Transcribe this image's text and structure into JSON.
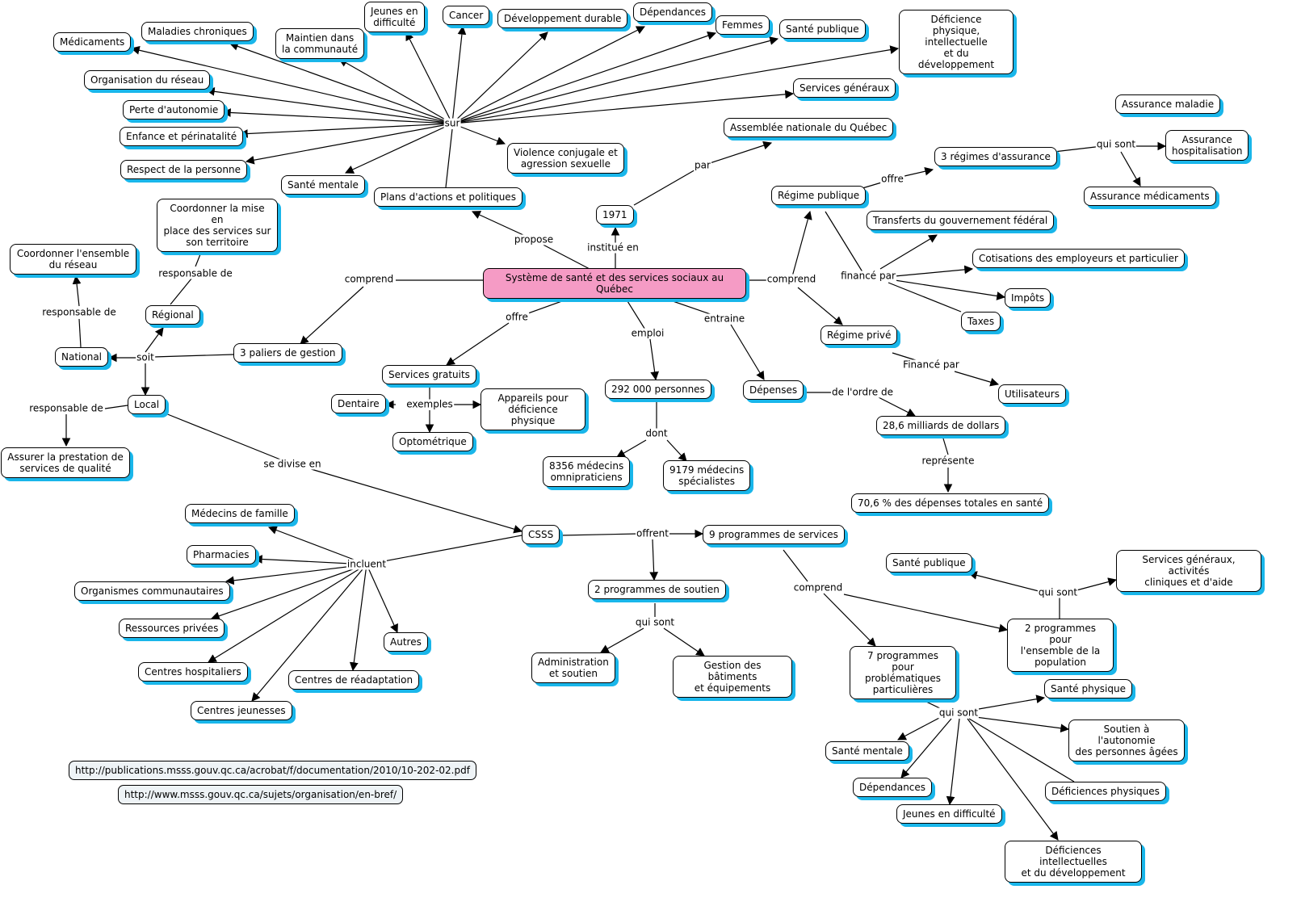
{
  "title": "Système de santé et des services sociaux au Québec",
  "colors": {
    "root_fill": "#f59bc5",
    "node_shadow": "#19b6ea",
    "link_fill": "#eef3f6"
  },
  "nodes": [
    {
      "id": "root",
      "text": "Système de santé et des services sociaux au Québec"
    },
    {
      "id": "medicaments",
      "text": "Médicaments"
    },
    {
      "id": "maladies",
      "text": "Maladies chroniques"
    },
    {
      "id": "maintien",
      "text": "Maintien dans\nla communauté"
    },
    {
      "id": "jeunes1",
      "text": "Jeunes en\ndifficulté"
    },
    {
      "id": "cancer",
      "text": "Cancer"
    },
    {
      "id": "devdurable",
      "text": "Développement durable"
    },
    {
      "id": "dependances1",
      "text": "Dépendances"
    },
    {
      "id": "femmes",
      "text": "Femmes"
    },
    {
      "id": "santepub1",
      "text": "Santé publique"
    },
    {
      "id": "deficience1",
      "text": "Déficience\nphysique,\nintellectuelle\net du développement"
    },
    {
      "id": "orgreseau",
      "text": "Organisation du réseau"
    },
    {
      "id": "perteauto",
      "text": "Perte d'autonomie"
    },
    {
      "id": "enfance",
      "text": "Enfance et périnatalité"
    },
    {
      "id": "respect",
      "text": "Respect de la personne"
    },
    {
      "id": "santement1",
      "text": "Santé mentale"
    },
    {
      "id": "plans",
      "text": "Plans d'actions et politiques"
    },
    {
      "id": "violence",
      "text": "Violence conjugale et\nagression sexuelle"
    },
    {
      "id": "servgen1",
      "text": "Services généraux"
    },
    {
      "id": "assemblee",
      "text": "Assemblée nationale du Québec"
    },
    {
      "id": "y1971",
      "text": "1971"
    },
    {
      "id": "assmaladie",
      "text": "Assurance maladie"
    },
    {
      "id": "regpub",
      "text": "Régime publique"
    },
    {
      "id": "regimes3",
      "text": "3 régimes d'assurance"
    },
    {
      "id": "asshosp",
      "text": "Assurance\nhospitalisation"
    },
    {
      "id": "assmed",
      "text": "Assurance médicaments"
    },
    {
      "id": "transferts",
      "text": "Transferts du gouvernement fédéral"
    },
    {
      "id": "cotisations",
      "text": "Cotisations des employeurs et particulier"
    },
    {
      "id": "impots",
      "text": "Impôts"
    },
    {
      "id": "taxes",
      "text": "Taxes"
    },
    {
      "id": "regprive",
      "text": "Régime privé"
    },
    {
      "id": "utilisateurs",
      "text": "Utilisateurs"
    },
    {
      "id": "coordmise",
      "text": "Coordonner la mise en\nplace des services sur\nson territoire"
    },
    {
      "id": "coordens",
      "text": "Coordonner l'ensemble\ndu réseau"
    },
    {
      "id": "regional",
      "text": "Régional"
    },
    {
      "id": "national",
      "text": "National"
    },
    {
      "id": "paliers",
      "text": "3 paliers de gestion"
    },
    {
      "id": "local",
      "text": "Local"
    },
    {
      "id": "assurer",
      "text": "Assurer la prestation de\nservices de qualité"
    },
    {
      "id": "servgratuits",
      "text": "Services gratuits"
    },
    {
      "id": "dentaire",
      "text": "Dentaire"
    },
    {
      "id": "appareils",
      "text": "Appareils pour\ndéficience physique"
    },
    {
      "id": "optometrique",
      "text": "Optométrique"
    },
    {
      "id": "personnes",
      "text": "292 000 personnes"
    },
    {
      "id": "omni",
      "text": "8356 médecins\nomnipraticiens"
    },
    {
      "id": "specialistes",
      "text": "9179 médecins\nspécialistes"
    },
    {
      "id": "depenses",
      "text": "Dépenses"
    },
    {
      "id": "milliards",
      "text": "28,6 milliards de dollars"
    },
    {
      "id": "pourcent",
      "text": "70,6 % des dépenses totales en santé"
    },
    {
      "id": "medfamille",
      "text": "Médecins de famille"
    },
    {
      "id": "pharmacies",
      "text": "Pharmacies"
    },
    {
      "id": "organismes",
      "text": "Organismes communautaires"
    },
    {
      "id": "ressources",
      "text": "Ressources privées"
    },
    {
      "id": "hospitaliers",
      "text": "Centres hospitaliers"
    },
    {
      "id": "jeunesses",
      "text": "Centres jeunesses"
    },
    {
      "id": "readaptation",
      "text": "Centres de réadaptation"
    },
    {
      "id": "autres",
      "text": "Autres"
    },
    {
      "id": "csss",
      "text": "CSSS"
    },
    {
      "id": "prog9",
      "text": "9 programmes de services"
    },
    {
      "id": "prog2soutien",
      "text": "2 programmes de soutien"
    },
    {
      "id": "admin",
      "text": "Administration\net soutien"
    },
    {
      "id": "gestion",
      "text": "Gestion des bâtiments\net équipements"
    },
    {
      "id": "santepub2",
      "text": "Santé publique"
    },
    {
      "id": "servgen2",
      "text": "Services généraux, activités\ncliniques et d'aide"
    },
    {
      "id": "prog2pop",
      "text": "2 programmes pour\nl'ensemble de la\npopulation"
    },
    {
      "id": "prog7",
      "text": "7 programmes pour\nproblématiques\nparticulières"
    },
    {
      "id": "santephys",
      "text": "Santé physique"
    },
    {
      "id": "soutienauto",
      "text": "Soutien à l'autonomie\ndes personnes âgées"
    },
    {
      "id": "santement2",
      "text": "Santé mentale"
    },
    {
      "id": "dependances2",
      "text": "Dépendances"
    },
    {
      "id": "jeunes2",
      "text": "Jeunes en difficulté"
    },
    {
      "id": "defphys",
      "text": "Déficiences physiques"
    },
    {
      "id": "defintel",
      "text": "Déficiences intellectuelles\net du développement"
    }
  ],
  "resource_links": [
    {
      "id": "url1",
      "text": "http://publications.msss.gouv.qc.ca/acrobat/f/documentation/2010/10-202-02.pdf"
    },
    {
      "id": "url2",
      "text": "http://www.msss.gouv.qc.ca/sujets/organisation/en-bref/"
    }
  ],
  "link_labels": [
    {
      "id": "sur",
      "text": "sur"
    },
    {
      "id": "propose",
      "text": "propose"
    },
    {
      "id": "institue",
      "text": "institué en"
    },
    {
      "id": "par",
      "text": "par"
    },
    {
      "id": "comprend_l",
      "text": "comprend"
    },
    {
      "id": "comprend_r",
      "text": "comprend"
    },
    {
      "id": "offre_root",
      "text": "offre"
    },
    {
      "id": "emploi",
      "text": "emploi"
    },
    {
      "id": "entraine",
      "text": "entraine"
    },
    {
      "id": "offre_pub",
      "text": "offre"
    },
    {
      "id": "quisont_ass",
      "text": "qui sont"
    },
    {
      "id": "finance_par",
      "text": "financé par"
    },
    {
      "id": "Finance_par",
      "text": "Financé par"
    },
    {
      "id": "soit",
      "text": "soit"
    },
    {
      "id": "resp_reg",
      "text": "responsable de"
    },
    {
      "id": "resp_nat",
      "text": "responsable de"
    },
    {
      "id": "resp_loc",
      "text": "responsable de"
    },
    {
      "id": "exemples",
      "text": "exemples"
    },
    {
      "id": "dont",
      "text": "dont"
    },
    {
      "id": "ordre",
      "text": "de l'ordre de"
    },
    {
      "id": "represente",
      "text": "représente"
    },
    {
      "id": "divise",
      "text": "se divise en"
    },
    {
      "id": "incluent",
      "text": "incluent"
    },
    {
      "id": "offrent",
      "text": "offrent"
    },
    {
      "id": "quisont_sout",
      "text": "qui sont"
    },
    {
      "id": "comprend_prog",
      "text": "comprend"
    },
    {
      "id": "quisont_pop",
      "text": "qui sont"
    },
    {
      "id": "quisont_7",
      "text": "qui sont"
    }
  ]
}
